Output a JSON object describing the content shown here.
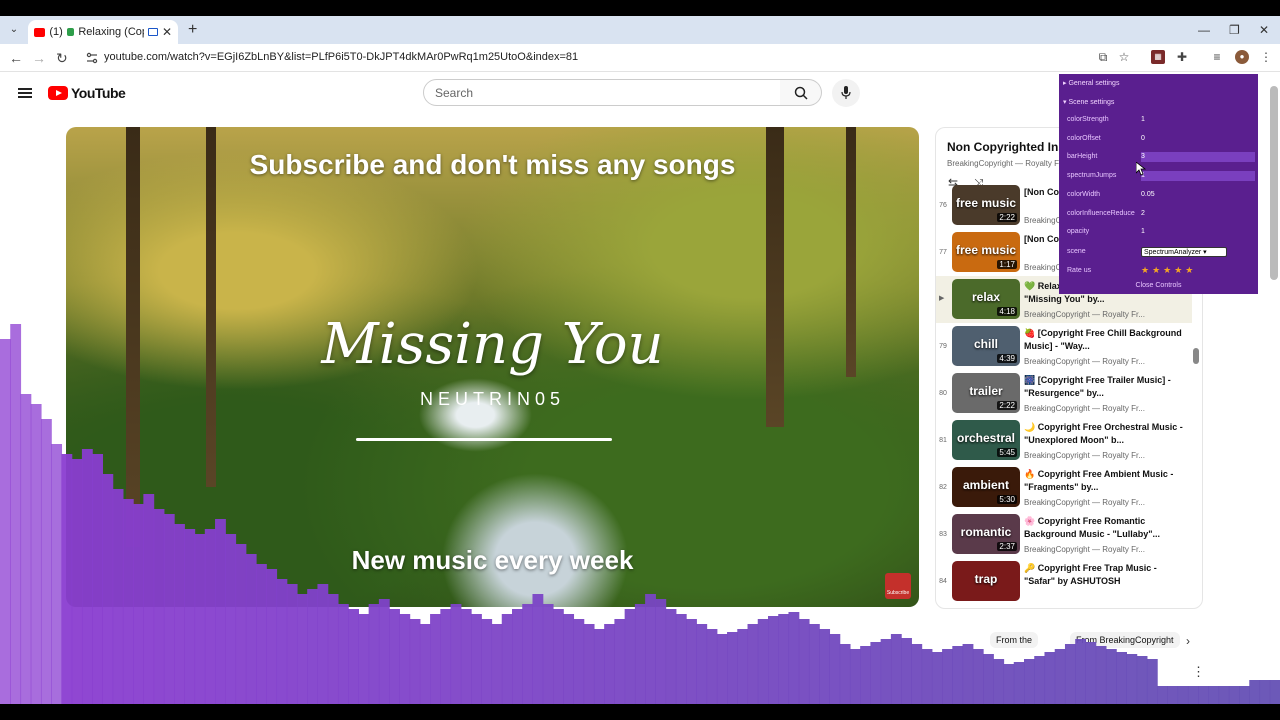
{
  "browser": {
    "tab": {
      "count": "(1)",
      "title": "Relaxing (Copyright"
    },
    "url": "youtube.com/watch?v=EGjI6ZbLnBY&list=PLfP6i5T0-DkJPT4dkMAr0PwRq1m25UtoO&index=81"
  },
  "youtube": {
    "logo_text": "YouTube",
    "search_placeholder": "Search"
  },
  "video": {
    "top_text": "Subscribe and don't miss any songs",
    "song_title": "Missing You",
    "artist": "NEUTRIN05",
    "bottom_text": "New music every week",
    "subscribe_badge": "Subscribe"
  },
  "playlist": {
    "title": "Non Copyrighted Ins",
    "subtitle": "BreakingCopyright — Royalty Fre",
    "items": [
      {
        "num": "76",
        "thumb_label": "free music",
        "duration": "2:22",
        "title": "[Non Cop... Meixsell",
        "channel": "BreakingC...",
        "color": "#4a3a2a"
      },
      {
        "num": "77",
        "thumb_label": "free music",
        "duration": "1:17",
        "title": "[Non Cop... Jingle P...",
        "channel": "BreakingC...",
        "color": "#c96a10"
      },
      {
        "num": "",
        "thumb_label": "relax",
        "duration": "4:18",
        "title": "💚 Relaxing (Copyright Free Music) - \"Missing You\" by...",
        "channel": "BreakingCopyright — Royalty Fr...",
        "color": "#4b6a2a"
      },
      {
        "num": "79",
        "thumb_label": "chill",
        "duration": "4:39",
        "title": "🍓 [Copyright Free Chill Background Music] - \"Way...",
        "channel": "BreakingCopyright — Royalty Fr...",
        "color": "#4f5f6f"
      },
      {
        "num": "80",
        "thumb_label": "trailer",
        "duration": "2:22",
        "title": "🎆 [Copyright Free Trailer Music] - \"Resurgence\" by...",
        "channel": "BreakingCopyright — Royalty Fr...",
        "color": "#6a6a6a"
      },
      {
        "num": "81",
        "thumb_label": "orchestral",
        "duration": "5:45",
        "title": "🌙 Copyright Free Orchestral Music - \"Unexplored Moon\" b...",
        "channel": "BreakingCopyright — Royalty Fr...",
        "color": "#2f5a4a"
      },
      {
        "num": "82",
        "thumb_label": "ambient",
        "duration": "5:30",
        "title": "🔥 Copyright Free Ambient Music - \"Fragments\" by...",
        "channel": "BreakingCopyright — Royalty Fr...",
        "color": "#3a1a0a"
      },
      {
        "num": "83",
        "thumb_label": "romantic",
        "duration": "2:37",
        "title": "🌸 Copyright Free Romantic Background Music - \"Lullaby\"...",
        "channel": "BreakingCopyright — Royalty Fr...",
        "color": "#5a3a4a"
      },
      {
        "num": "84",
        "thumb_label": "trap",
        "duration": "",
        "title": "🔑 Copyright Free Trap Music - \"Safar\" by ASHUTOSH",
        "channel": "",
        "color": "#7a1a1a"
      }
    ]
  },
  "chips": {
    "a": "From the",
    "b": "From BreakingCopyright"
  },
  "settings": {
    "general": "General settings",
    "scene_settings": "Scene settings",
    "rows": [
      {
        "label": "colorStrength",
        "value": "1"
      },
      {
        "label": "colorOffset",
        "value": "0"
      },
      {
        "label": "barHeight",
        "value": "3"
      },
      {
        "label": "spectrumJumps",
        "value": "1"
      },
      {
        "label": "colorWidth",
        "value": "0.05"
      },
      {
        "label": "colorInfluenceReduce",
        "value": "2"
      },
      {
        "label": "opacity",
        "value": "1"
      }
    ],
    "scene_label": "scene",
    "scene_value": "SpectrumAnalyzer",
    "rate_label": "Rate us",
    "stars": "★★★★★",
    "close": "Close Controls"
  }
}
